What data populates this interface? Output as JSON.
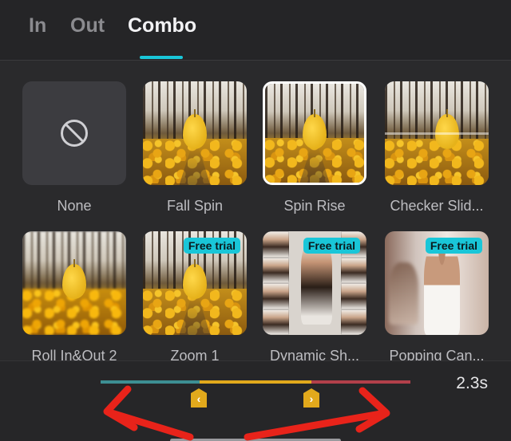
{
  "tabs": [
    {
      "label": "In",
      "active": false
    },
    {
      "label": "Out",
      "active": false
    },
    {
      "label": "Combo",
      "active": true
    }
  ],
  "items": [
    {
      "label": "None",
      "badge": ""
    },
    {
      "label": "Fall Spin",
      "badge": ""
    },
    {
      "label": "Spin Rise",
      "badge": "",
      "selected": true
    },
    {
      "label": "Checker Slid...",
      "badge": ""
    },
    {
      "label": "Roll In&Out 2",
      "badge": ""
    },
    {
      "label": "Zoom 1",
      "badge": "Free trial"
    },
    {
      "label": "Dynamic Sh...",
      "badge": "Free trial"
    },
    {
      "label": "Popping Can...",
      "badge": "Free trial"
    }
  ],
  "timeline": {
    "duration": "2.3s",
    "left_handle_glyph": "‹",
    "right_handle_glyph": "›"
  },
  "colors": {
    "accent": "#19c6d8",
    "track_in": "#3d8f93",
    "track_mid": "#e2a91c",
    "track_out": "#b2404a",
    "annotation_arrow": "#e8231a"
  }
}
